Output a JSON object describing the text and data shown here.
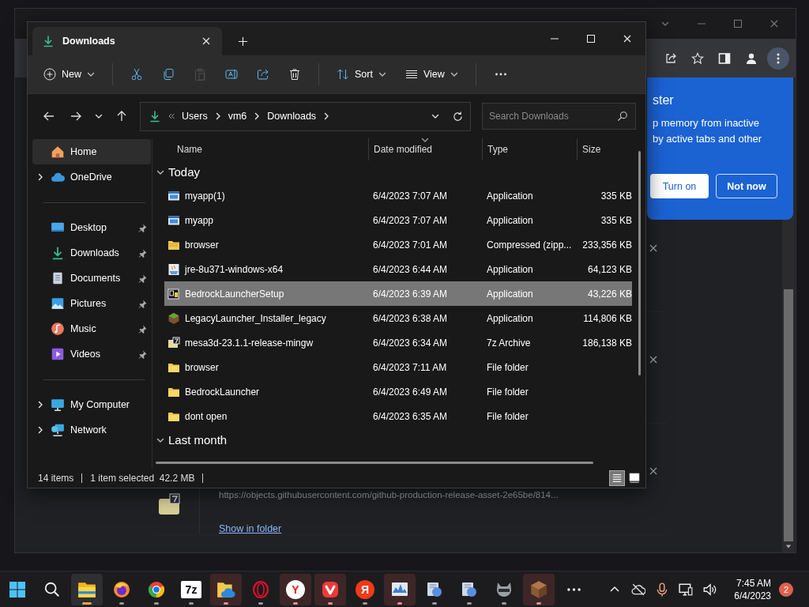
{
  "browser": {
    "popup": {
      "title": "ster",
      "lines": [
        "p memory from inactive",
        "by active tabs and other"
      ],
      "buttons": [
        {
          "label": "Turn on",
          "kind": "secondary"
        },
        {
          "label": "Not now",
          "kind": "primary"
        }
      ]
    },
    "downloads": [
      {
        "kind": "covered"
      },
      {
        "kind": "covered"
      },
      {
        "kind": "file",
        "url": "https://objects.githubusercontent.com/github-production-release-asset-2e65be/814...",
        "link": "Show in folder"
      }
    ]
  },
  "explorer": {
    "tabs": [
      {
        "label": "Downloads",
        "selected": true
      }
    ],
    "toolbar": [
      [
        {
          "kind": "new",
          "label": "New",
          "disabled": false
        }
      ],
      [
        {
          "kind": "cut",
          "disabled": false
        },
        {
          "kind": "copy",
          "disabled": false
        },
        {
          "kind": "paste",
          "disabled": true
        },
        {
          "kind": "rename",
          "disabled": false
        },
        {
          "kind": "share",
          "disabled": false
        },
        {
          "kind": "delete",
          "disabled": false
        }
      ],
      [
        {
          "kind": "sort",
          "label": "Sort",
          "disabled": false
        },
        {
          "kind": "view",
          "label": "View",
          "disabled": false
        }
      ],
      [
        {
          "kind": "more",
          "disabled": false
        }
      ]
    ],
    "address": [
      "Users",
      "vm6",
      "Downloads"
    ],
    "search": {
      "placeholder": "Search Downloads"
    },
    "sidebar": [
      [
        {
          "label": "Home",
          "kind": "home",
          "selected": true,
          "pinned": false
        },
        {
          "label": "OneDrive",
          "kind": "cloud",
          "selected": false,
          "pinned": false,
          "expanded": false
        }
      ],
      [
        {
          "label": "Desktop",
          "kind": "desktop",
          "selected": false,
          "pinned": true
        },
        {
          "label": "Downloads",
          "kind": "download",
          "selected": false,
          "pinned": true
        },
        {
          "label": "Documents",
          "kind": "document",
          "selected": false,
          "pinned": true
        },
        {
          "label": "Pictures",
          "kind": "picture",
          "selected": false,
          "pinned": true
        },
        {
          "label": "Music",
          "kind": "music",
          "selected": false,
          "pinned": true
        },
        {
          "label": "Videos",
          "kind": "video",
          "selected": false,
          "pinned": true
        }
      ],
      [
        {
          "label": "My Computer",
          "kind": "computer",
          "selected": false,
          "pinned": false,
          "expanded": false
        },
        {
          "label": "Network",
          "kind": "network",
          "selected": false,
          "pinned": false,
          "expanded": false
        }
      ]
    ],
    "columns": [
      {
        "label": "Name",
        "sorted": false
      },
      {
        "label": "Date modified",
        "sorted": true
      },
      {
        "label": "Type",
        "sorted": false
      },
      {
        "label": "Size",
        "sorted": false
      }
    ],
    "groups": [
      {
        "label": "Today",
        "expanded": true,
        "rows": [
          {
            "name": "myapp(1)",
            "date": "6/4/2023 7:07 AM",
            "type": "Application",
            "size": "335 KB",
            "kind": "app",
            "selected": false
          },
          {
            "name": "myapp",
            "date": "6/4/2023 7:07 AM",
            "type": "Application",
            "size": "335 KB",
            "kind": "app",
            "selected": false
          },
          {
            "name": "browser",
            "date": "6/4/2023 7:01 AM",
            "type": "Compressed (zipp...",
            "size": "233,356 KB",
            "kind": "zip",
            "selected": false
          },
          {
            "name": "jre-8u371-windows-x64",
            "date": "6/4/2023 6:44 AM",
            "type": "Application",
            "size": "64,123 KB",
            "kind": "installer",
            "selected": false
          },
          {
            "name": "BedrockLauncherSetup",
            "date": "6/4/2023 6:39 AM",
            "type": "Application",
            "size": "43,226 KB",
            "kind": "sfx",
            "selected": true
          },
          {
            "name": "LegacyLauncher_Installer_legacy",
            "date": "6/4/2023 6:38 AM",
            "type": "Application",
            "size": "114,806 KB",
            "kind": "block",
            "selected": false
          },
          {
            "name": "mesa3d-23.1.1-release-mingw",
            "date": "6/4/2023 6:34 AM",
            "type": "7z Archive",
            "size": "186,138 KB",
            "kind": "archive",
            "selected": false
          },
          {
            "name": "browser",
            "date": "6/4/2023 7:11 AM",
            "type": "File folder",
            "kind": "folder",
            "selected": false
          },
          {
            "name": "BedrockLauncher",
            "date": "6/4/2023 6:49 AM",
            "type": "File folder",
            "kind": "folder",
            "selected": false
          },
          {
            "name": "dont open",
            "date": "6/4/2023 6:35 AM",
            "type": "File folder",
            "kind": "folder",
            "selected": false
          }
        ]
      },
      {
        "label": "Last month",
        "expanded": true
      }
    ],
    "status": {
      "count": "14 items",
      "selection": "1 item selected",
      "size": "42.2 MB"
    },
    "views": [
      {
        "kind": "details",
        "selected": true
      },
      {
        "kind": "preview",
        "selected": false
      }
    ]
  },
  "taskbar": {
    "apps": [
      {
        "kind": "start",
        "running": false,
        "active": false,
        "highlighted": false
      },
      {
        "kind": "search",
        "running": false,
        "active": false,
        "highlighted": false
      },
      {
        "kind": "explorer",
        "running": true,
        "active": true,
        "highlighted": false
      },
      {
        "kind": "firefox",
        "running": true,
        "active": false,
        "highlighted": false
      },
      {
        "kind": "chrome",
        "running": true,
        "active": false,
        "highlighted": false
      },
      {
        "kind": "sevenzip",
        "label": "7z",
        "running": true,
        "active": false,
        "highlighted": false
      },
      {
        "kind": "cloud-folder",
        "running": true,
        "active": false,
        "highlighted": true
      },
      {
        "kind": "opera",
        "running": true,
        "active": false,
        "highlighted": false
      },
      {
        "kind": "yandex-browser",
        "label": "Y",
        "running": true,
        "active": false,
        "highlighted": true
      },
      {
        "kind": "vivaldi",
        "running": true,
        "active": false,
        "highlighted": true
      },
      {
        "kind": "yandex",
        "label": "Я",
        "running": true,
        "active": false,
        "highlighted": false
      },
      {
        "kind": "monitor",
        "running": true,
        "active": false,
        "highlighted": true
      },
      {
        "kind": "gadget",
        "running": true,
        "active": false,
        "highlighted": false
      },
      {
        "kind": "gadget",
        "running": true,
        "active": false,
        "highlighted": false
      },
      {
        "kind": "animal",
        "running": true,
        "active": false,
        "highlighted": false
      },
      {
        "kind": "box",
        "running": true,
        "active": false,
        "highlighted": true
      },
      {
        "kind": "more",
        "running": false,
        "active": false,
        "highlighted": false
      }
    ],
    "tray": [
      {
        "kind": "chevron"
      },
      {
        "kind": "cloud-off"
      },
      {
        "kind": "mic"
      },
      {
        "kind": "network"
      },
      {
        "kind": "volume"
      }
    ],
    "time": "7:45 AM",
    "date": "6/4/2023",
    "badge": "2"
  }
}
